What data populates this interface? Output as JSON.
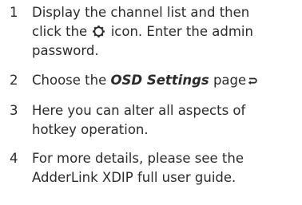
{
  "steps": [
    {
      "number": "1",
      "line1": "Display the channel list and then",
      "line2_before": "click the",
      "icon": "gear-icon",
      "line2_after": "icon. Enter the admin",
      "line3": "password."
    },
    {
      "number": "2",
      "before": "Choose the ",
      "emphasis": "OSD Settings",
      "after": " page",
      "icon": "return-arrow-icon"
    },
    {
      "number": "3",
      "line1": "Here you can alter all aspects of",
      "line2": "hotkey operation."
    },
    {
      "number": "4",
      "line1": "For more details, please see the",
      "line2": "AdderLink XDIP full user guide."
    }
  ]
}
